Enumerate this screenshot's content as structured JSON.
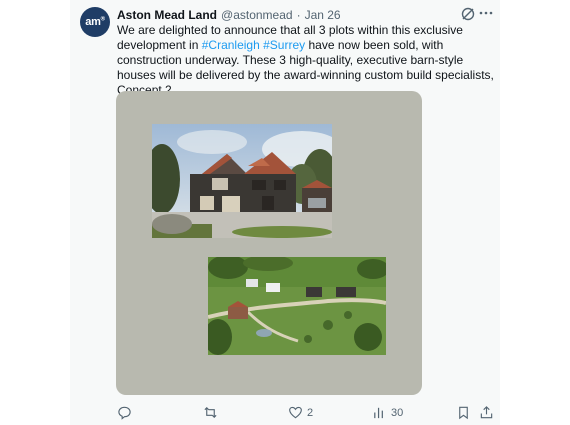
{
  "tweet": {
    "avatar_text": "am",
    "avatar_sup": "®",
    "display_name": "Aston Mead Land",
    "handle": "@astonmead",
    "separator": "·",
    "date": "Jan 26",
    "text_1": "We are delighted to announce that all 3 plots within this exclusive development in ",
    "hashtag_1": "#Cranleigh",
    "text_2": " ",
    "hashtag_2": "#Surrey",
    "text_3": " have now been sold, with construction underway.  These 3 high-quality, executive barn-style houses will be delivered by the award-winning custom build specialists, Concept 2.",
    "media_bg": "#b8b9af"
  },
  "actions": {
    "reply_count": "",
    "repost_count": "",
    "like_count": "2",
    "views_count": "30"
  },
  "colors": {
    "link": "#1d9bf0",
    "muted": "#536471",
    "avatar": "#1f3d66"
  },
  "icons": [
    "grok-icon",
    "more-icon",
    "reply-icon",
    "repost-icon",
    "like-icon",
    "views-icon",
    "bookmark-icon",
    "share-icon"
  ]
}
